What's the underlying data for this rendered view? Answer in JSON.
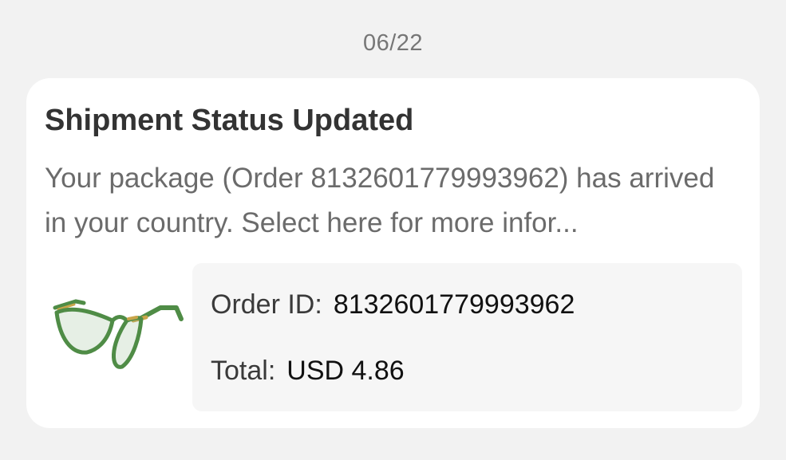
{
  "date": "06/22",
  "notification": {
    "title": "Shipment Status Updated",
    "message": "Your package (Order 8132601779993962) has arrived in your country. Select here for more infor...",
    "product_image": "green cat-eye eyeglasses",
    "order_id_label": "Order ID:",
    "order_id_value": "8132601779993962",
    "total_label": "Total:",
    "total_value": "USD 4.86"
  },
  "colors": {
    "background": "#f2f2f2",
    "card": "#ffffff",
    "info_panel": "#f6f6f6",
    "frame_green": "#4f8c46",
    "temple_gold": "#c9a54a"
  }
}
